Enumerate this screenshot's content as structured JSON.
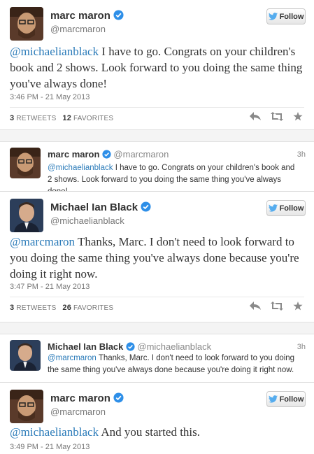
{
  "colors": {
    "link": "#2b7bb9",
    "verified": "#2e8fe8",
    "bird": "#55acee",
    "gap": "#f4f4f4"
  },
  "tweet1": {
    "fullname": "marc maron",
    "handle": "@marcmaron",
    "follow": "Follow",
    "mention": "@michaelianblack",
    "text": " I have to go. Congrats on your children's book and 2 shows. Look forward to you doing the same thing you've always done!",
    "timestamp": "3:46 PM - 21 May 2013",
    "retweets": "3",
    "retweets_label": "RETWEETS",
    "favorites": "12",
    "favorites_label": "FAVORITES"
  },
  "embed1": {
    "fullname": "marc maron",
    "handle": "@marcmaron",
    "time": "3h",
    "mention": "@michaelianblack",
    "text": " I have to go. Congrats on your children's book and 2 shows. Look forward to you doing the same thing you've always done!"
  },
  "tweet2": {
    "fullname": "Michael Ian Black",
    "handle": "@michaelianblack",
    "follow": "Follow",
    "mention": "@marcmaron",
    "text": " Thanks, Marc. I don't need to look forward to you doing the same thing you've always done because you're doing it right now.",
    "timestamp": "3:47 PM - 21 May 2013",
    "retweets": "3",
    "retweets_label": "RETWEETS",
    "favorites": "26",
    "favorites_label": "FAVORITES"
  },
  "embed2": {
    "fullname": "Michael Ian Black",
    "handle": "@michaelianblack",
    "time": "3h",
    "mention": "@marcmaron",
    "text": " Thanks, Marc. I don't need to look forward to you doing the same thing you've always done because you're doing it right now."
  },
  "tweet3": {
    "fullname": "marc maron",
    "handle": "@marcmaron",
    "follow": "Follow",
    "mention": "@michaelianblack",
    "text": " And you started this.",
    "timestamp": "3:49 PM - 21 May 2013"
  }
}
